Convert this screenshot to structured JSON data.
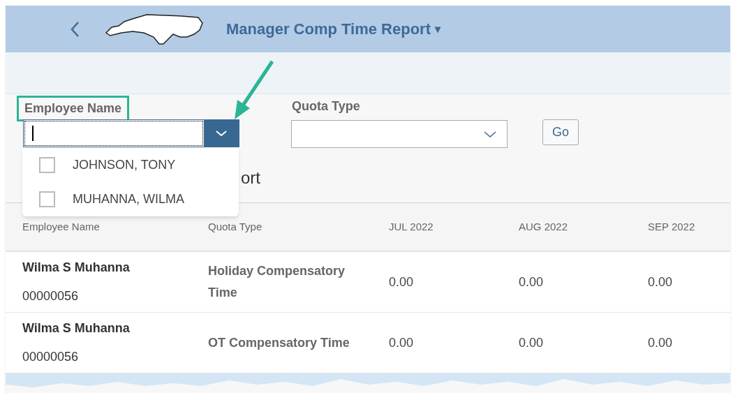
{
  "header": {
    "title": "Manager Comp Time Report",
    "menu_glyph": "▾"
  },
  "filters": {
    "employee_name": {
      "label": "Employee Name",
      "highlighted": true,
      "open": true,
      "options": [
        {
          "label": "JOHNSON, TONY",
          "checked": false
        },
        {
          "label": "MUHANNA, WILMA",
          "checked": false
        }
      ]
    },
    "quota_type": {
      "label": "Quota Type"
    },
    "go_button": "Go"
  },
  "report_title_fragment": "ort",
  "table": {
    "columns": [
      "Employee Name",
      "Quota Type",
      "JUL 2022",
      "AUG 2022",
      "SEP 2022"
    ],
    "rows": [
      {
        "name": "Wilma S Muhanna",
        "id": "00000056",
        "quota_type": "Holiday Compensatory Time",
        "values": [
          "0.00",
          "0.00",
          "0.00"
        ]
      },
      {
        "name": "Wilma S Muhanna",
        "id": "00000056",
        "quota_type": "OT Compensatory Time",
        "values": [
          "0.00",
          "0.00",
          "0.00"
        ]
      }
    ]
  }
}
